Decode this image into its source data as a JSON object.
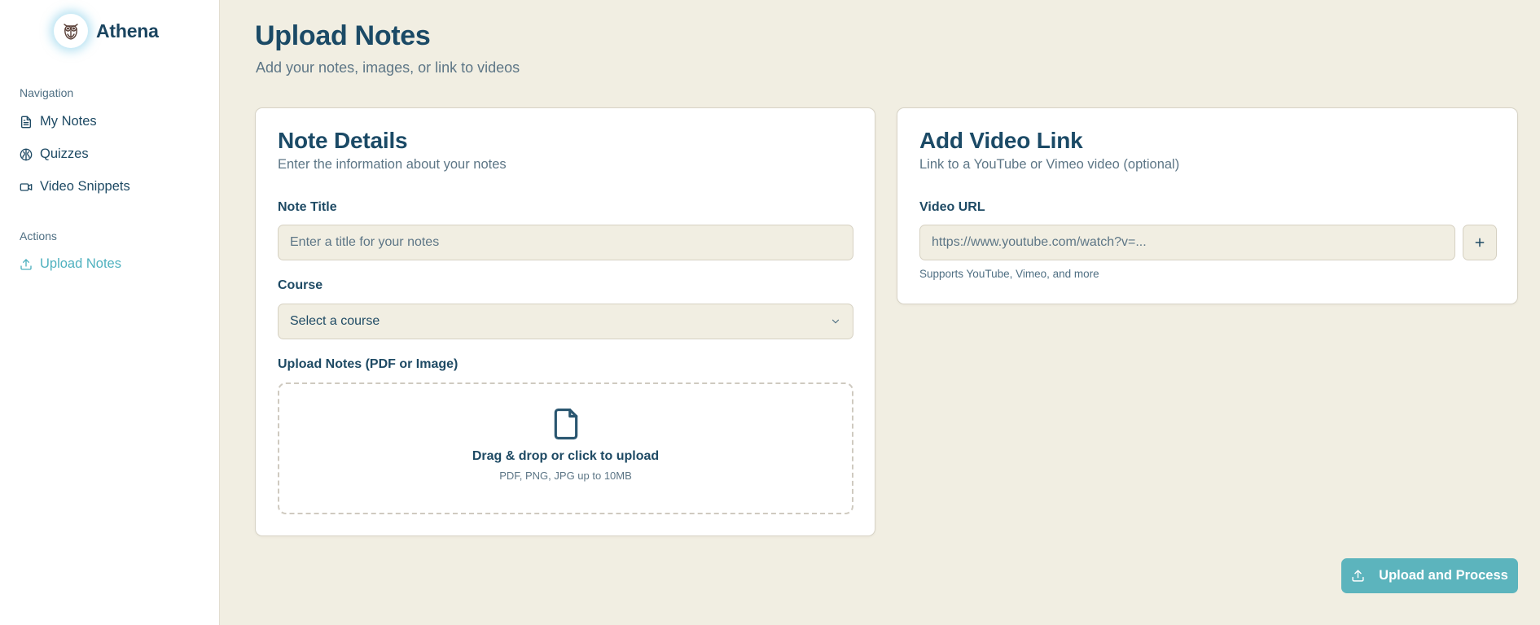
{
  "app": {
    "name": "Athena"
  },
  "sidebar": {
    "navigation_label": "Navigation",
    "nav_items": [
      {
        "label": "My Notes",
        "icon": "file-text-icon"
      },
      {
        "label": "Quizzes",
        "icon": "brain-icon"
      },
      {
        "label": "Video Snippets",
        "icon": "video-icon"
      }
    ],
    "actions_label": "Actions",
    "action_items": [
      {
        "label": "Upload Notes",
        "icon": "upload-icon",
        "active": true
      }
    ]
  },
  "page": {
    "title": "Upload Notes",
    "subtitle": "Add your notes, images, or link to videos"
  },
  "note_details": {
    "title": "Note Details",
    "description": "Enter the information about your notes",
    "title_label": "Note Title",
    "title_placeholder": "Enter a title for your notes",
    "title_value": "",
    "course_label": "Course",
    "course_selected": "Select a course",
    "upload_label": "Upload Notes (PDF or Image)",
    "dropzone_main": "Drag & drop or click to upload",
    "dropzone_sub": "PDF, PNG, JPG up to 10MB"
  },
  "video_link": {
    "title": "Add Video Link",
    "description": "Link to a YouTube or Vimeo video (optional)",
    "url_label": "Video URL",
    "url_placeholder": "https://www.youtube.com/watch?v=...",
    "url_value": "",
    "hint": "Supports YouTube, Vimeo, and more",
    "add_button": "+"
  },
  "footer": {
    "submit_label": "Upload and Process"
  },
  "colors": {
    "background": "#f1eee2",
    "primary_text": "#1b4a66",
    "accent": "#5cb4bd",
    "active_nav": "#4fb1bf"
  }
}
